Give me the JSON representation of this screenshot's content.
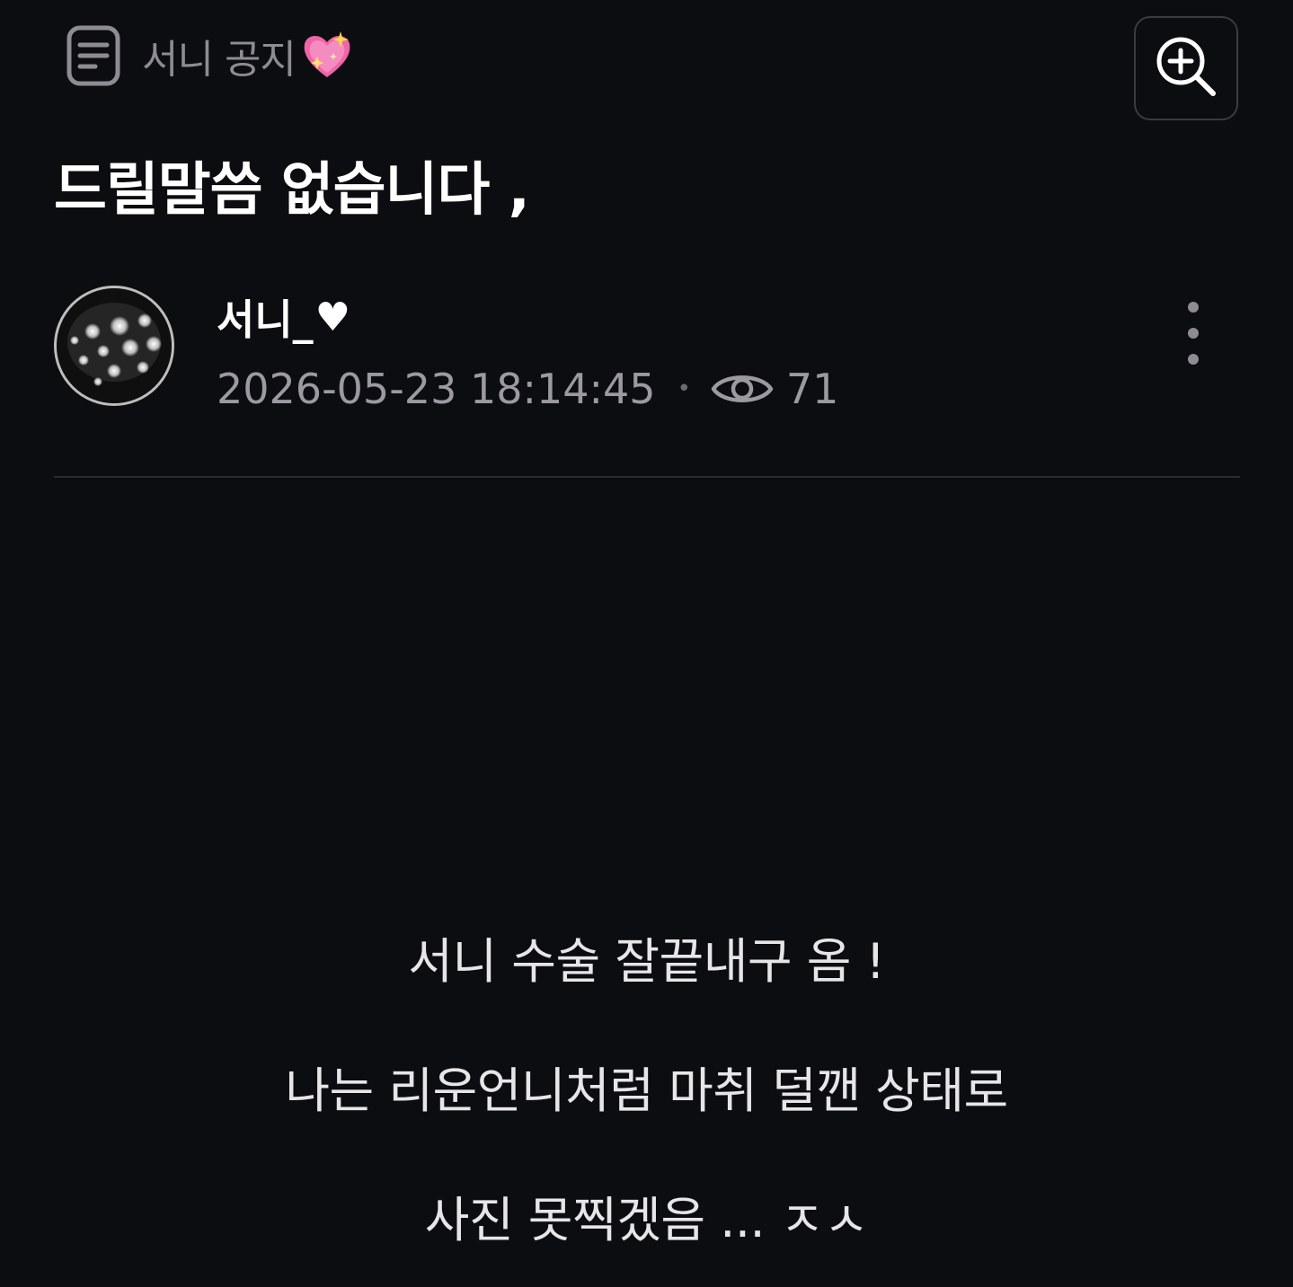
{
  "board": {
    "icon": "document-list-icon",
    "name": "서니 공지"
  },
  "header": {
    "zoom_icon": "zoom-in-icon"
  },
  "post": {
    "title": "드릴말씀 없습니다 ,",
    "author": "서니_",
    "timestamp": "2026-05-23 18:14:45",
    "view_icon": "eye-icon",
    "views": "71",
    "more_icon": "more-vertical-icon"
  },
  "content": {
    "lines": [
      "서니 수술 잘끝내구 옴 !",
      "나는 리운언니처럼 마취 덜깬 상태로",
      "사진 못찍겠음 ... ㅈㅅ"
    ]
  }
}
